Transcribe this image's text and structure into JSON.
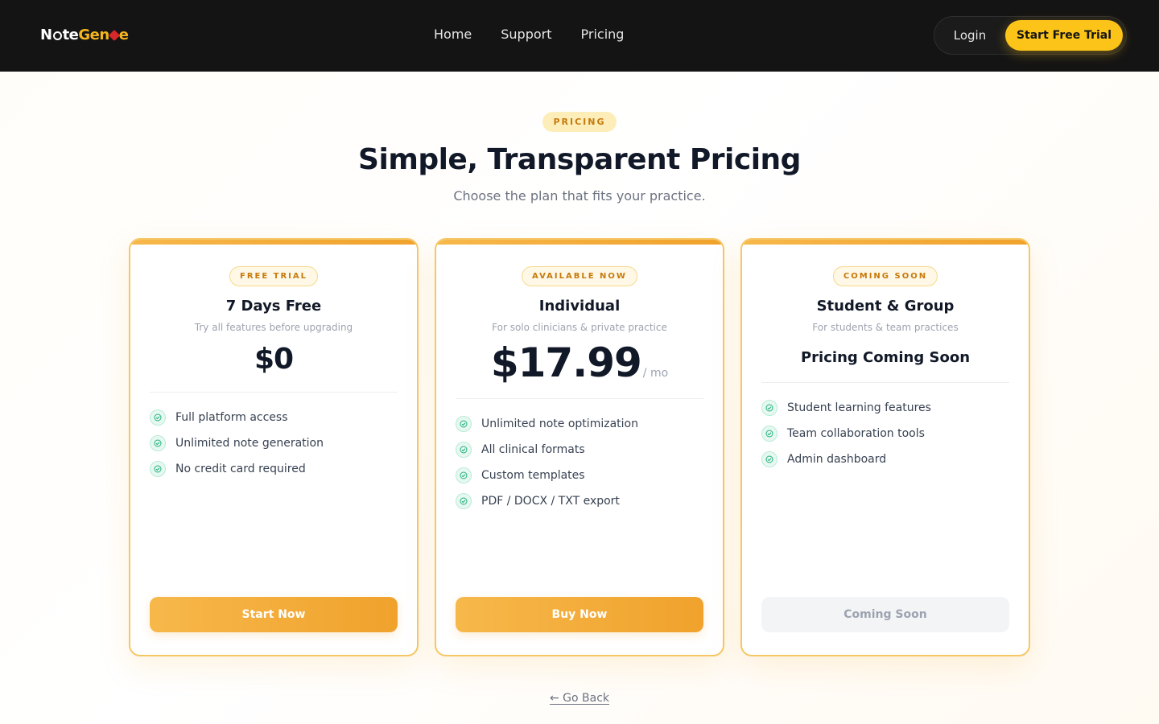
{
  "header": {
    "logo": {
      "part1": "N",
      "part2": "te",
      "part3": "Gen",
      "part4": "e"
    },
    "nav": [
      "Home",
      "Support",
      "Pricing"
    ],
    "login_label": "Login",
    "trial_label": "Start Free Trial",
    "colors": {
      "bg": "#141414",
      "accent": "#fcc419"
    }
  },
  "hero": {
    "badge": "PRICING",
    "title": "Simple, Transparent Pricing",
    "subtitle": "Choose the plan that fits your practice."
  },
  "plans": [
    {
      "pill": "FREE TRIAL",
      "name": "7 Days Free",
      "desc": "Try all features before upgrading",
      "price": "$0",
      "features": [
        "Full platform access",
        "Unlimited note generation",
        "No credit card required"
      ],
      "cta": "Start Now"
    },
    {
      "pill": "AVAILABLE NOW",
      "name": "Individual",
      "desc": "For solo clinicians & private practice",
      "price": "$17.99",
      "per": "/ mo",
      "features": [
        "Unlimited note optimization",
        "All clinical formats",
        "Custom templates",
        "PDF / DOCX / TXT export"
      ],
      "cta": "Buy Now"
    },
    {
      "pill": "COMING SOON",
      "name": "Student & Group",
      "desc": "For students & team practices",
      "price_text": "Pricing Coming Soon",
      "features": [
        "Student learning features",
        "Team collaboration tools",
        "Admin dashboard"
      ],
      "cta": "Coming Soon"
    }
  ],
  "footer": {
    "go_back": "← Go Back"
  },
  "icons": {
    "check": "check-circle-icon"
  }
}
